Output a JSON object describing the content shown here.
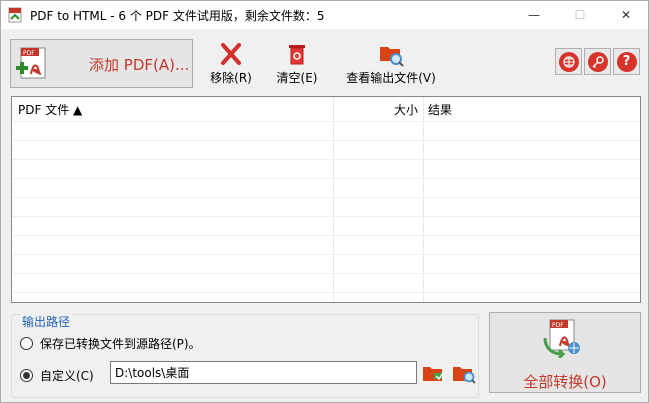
{
  "window": {
    "title": "PDF to HTML - 6 个 PDF 文件试用版，剩余文件数：5",
    "minimize_glyph": "—",
    "maximize_glyph": "☐",
    "close_glyph": "✕"
  },
  "toolbar": {
    "add_pdf_label": "添加 PDF(A)...",
    "remove_label": "移除(R)",
    "clear_label": "清空(E)",
    "view_output_label": "查看输出文件(V)",
    "help_glyph": "?"
  },
  "file_list": {
    "columns": [
      "PDF 文件 ▲",
      "大小",
      "结果"
    ],
    "rows": []
  },
  "output": {
    "group_title": "输出路径",
    "option_source_label": "保存已转换文件到源路径(P)。",
    "option_custom_label": "自定义(C)",
    "selected_option": "custom",
    "custom_path": "D:\\tools\\桌面"
  },
  "convert": {
    "label": "全部转换(O)"
  },
  "colors": {
    "accent_red": "#c0392b",
    "group_title_blue": "#1e64b4"
  },
  "icons": [
    "pdf-add-icon",
    "remove-x-icon",
    "trash-icon",
    "folder-search-icon",
    "globe-icon",
    "key-icon",
    "help-icon",
    "folder-browse-icon",
    "folder-open-icon",
    "pdf-convert-icon"
  ]
}
